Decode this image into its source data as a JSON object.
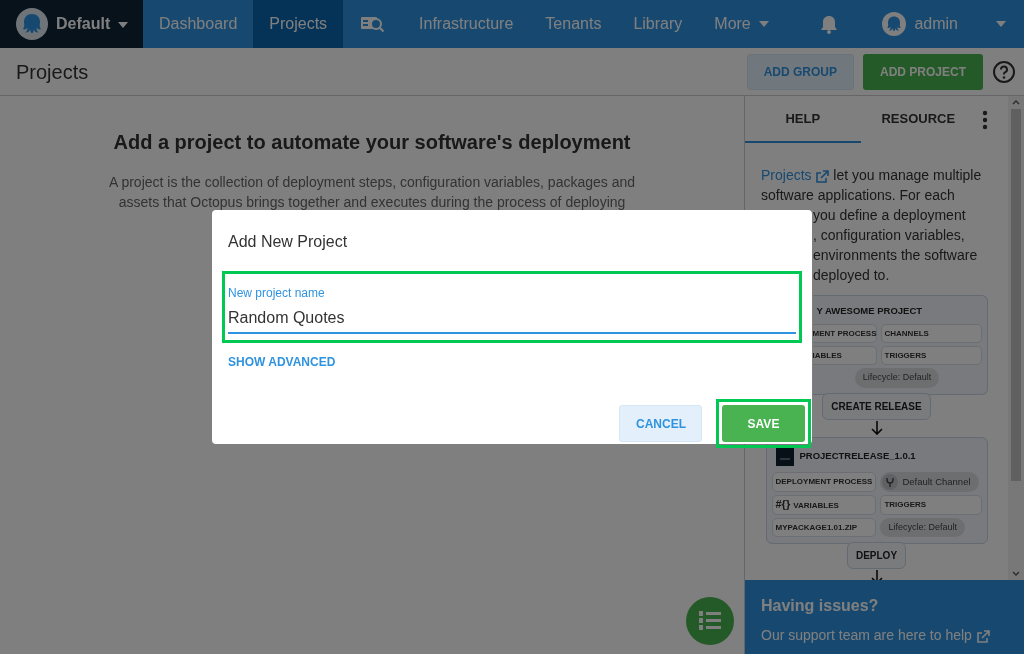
{
  "navbar": {
    "space": "Default",
    "items": [
      {
        "label": "Dashboard",
        "kind": "link",
        "selected": false
      },
      {
        "label": "Projects",
        "kind": "link",
        "selected": true
      },
      {
        "kind": "icon",
        "selected": false
      },
      {
        "label": "Infrastructure",
        "kind": "link",
        "selected": false
      },
      {
        "label": "Tenants",
        "kind": "link",
        "selected": false
      },
      {
        "label": "Library",
        "kind": "link",
        "selected": false
      },
      {
        "label": "More",
        "kind": "dropdown",
        "selected": false
      }
    ],
    "user": "admin"
  },
  "page_header": {
    "title": "Projects",
    "buttons": [
      {
        "label": "ADD GROUP",
        "kind": "secondary"
      },
      {
        "label": "ADD PROJECT",
        "kind": "primary"
      }
    ]
  },
  "empty_state": {
    "heading": "Add a project to automate your software's deployment",
    "lines": [
      "A project is the collection of deployment steps, configuration variables, packages and",
      "assets that Octopus brings together and executes during the process of deploying"
    ]
  },
  "help_panel": {
    "tabs": [
      {
        "label": "HELP",
        "selected": true
      },
      {
        "label": "RESOURCE",
        "selected": false
      }
    ],
    "intro": {
      "link": "Projects",
      "lines": [
        {
          "text": "let you manage multiple",
          "kind": "full"
        },
        {
          "text": "software applications. For each",
          "kind": "full"
        },
        {
          "text": "you define a deployment",
          "kind": "partial"
        },
        {
          "text": ", configuration variables,",
          "kind": "partial"
        },
        {
          "text": "environments the software",
          "kind": "partial"
        },
        {
          "text": "deployed to.",
          "kind": "partial"
        }
      ]
    },
    "diagram": {
      "project": {
        "title": "Y AWESOME PROJECT",
        "cells": [
          {
            "label": "MENT PROCESS",
            "kind": "tag"
          },
          {
            "label": "CHANNELS",
            "kind": "tag"
          },
          {
            "label": "IABLES",
            "kind": "tag"
          },
          {
            "label": "TRIGGERS",
            "kind": "tag"
          },
          {
            "label": "Lifecycle: Default",
            "kind": "pill"
          }
        ]
      },
      "create_button": "CREATE RELEASE",
      "release": {
        "title": "PROJECTRELEASE_1.0.1",
        "cells": [
          {
            "label": "DEPLOYMENT PROCESS",
            "kind": "tag"
          },
          {
            "label": "Default Channel",
            "kind": "chip"
          },
          {
            "label": "VARIABLES",
            "kind": "tag",
            "prefix": "#{}"
          },
          {
            "label": "TRIGGERS",
            "kind": "tag"
          },
          {
            "label": "MYPACKAGE1.01.ZIP",
            "kind": "tag"
          },
          {
            "label": "Lifecycle: Default",
            "kind": "pill"
          }
        ]
      },
      "deploy_button": "DEPLOY"
    },
    "support": {
      "title": "Having issues?",
      "link": "Our support team are here to help"
    }
  },
  "dialog": {
    "title": "Add New Project",
    "field": {
      "label": "New project name",
      "value": "Random Quotes",
      "highlighted": true
    },
    "link": "SHOW ADVANCED",
    "buttons": [
      {
        "label": "CANCEL",
        "kind": "secondary",
        "highlighted": false
      },
      {
        "label": "SAVE",
        "kind": "primary",
        "highlighted": true
      }
    ]
  }
}
